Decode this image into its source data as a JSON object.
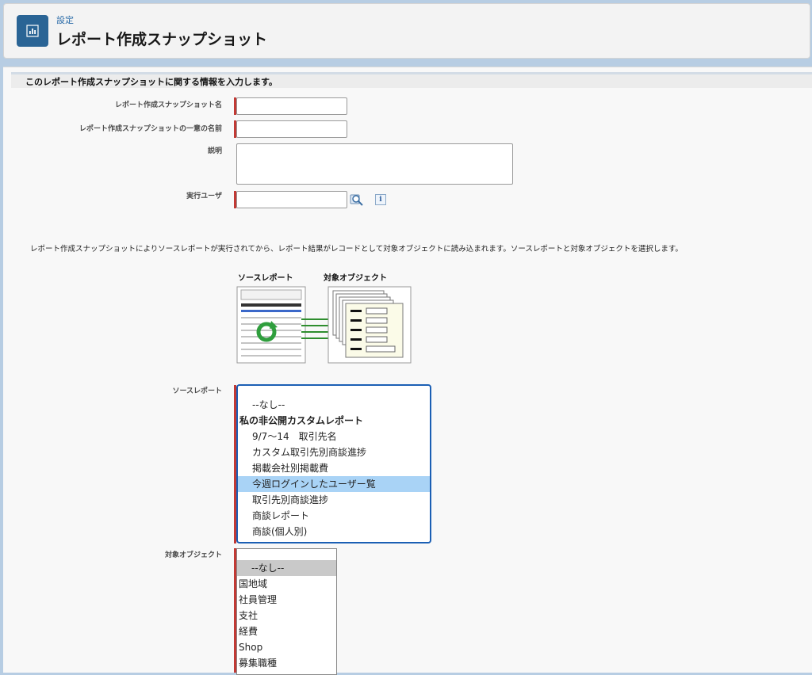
{
  "header": {
    "breadcrumb": "設定",
    "title": "レポート作成スナップショット"
  },
  "section": {
    "title": "このレポート作成スナップショットに関する情報を入力します。"
  },
  "form": {
    "name_label": "レポート作成スナップショット名",
    "unique_name_label": "レポート作成スナップショットの一意の名前",
    "description_label": "説明",
    "running_user_label": "実行ユーザ",
    "name_value": "",
    "unique_name_value": "",
    "description_value": "",
    "running_user_value": ""
  },
  "description_text": "レポート作成スナップショットによりソースレポートが実行されてから、レポート結果がレコードとして対象オブジェクトに読み込まれます。ソースレポートと対象オブジェクトを選択します。",
  "diagram": {
    "source_label": "ソースレポート",
    "target_label": "対象オブジェクト"
  },
  "source_report": {
    "label": "ソースレポート",
    "options": [
      {
        "text": "--なし--",
        "kind": "option"
      },
      {
        "text": "私の非公開カスタムレポート",
        "kind": "group"
      },
      {
        "text": "9/7〜14　取引先名",
        "kind": "option"
      },
      {
        "text": "カスタム取引先別商談進捗",
        "kind": "option"
      },
      {
        "text": "掲載会社別掲載費",
        "kind": "option"
      },
      {
        "text": "今週ログインしたユーザー覧",
        "kind": "selected"
      },
      {
        "text": "取引先別商談進捗",
        "kind": "option"
      },
      {
        "text": "商談レポート",
        "kind": "option"
      },
      {
        "text": "商談(個人別)",
        "kind": "option"
      }
    ]
  },
  "target_object": {
    "label": "対象オブジェクト",
    "options": [
      {
        "text": "--なし--",
        "kind": "grey-selected"
      },
      {
        "text": "国地域",
        "kind": "plain"
      },
      {
        "text": "社員管理",
        "kind": "plain"
      },
      {
        "text": "支社",
        "kind": "plain"
      },
      {
        "text": "経費",
        "kind": "plain"
      },
      {
        "text": "Shop",
        "kind": "plain"
      },
      {
        "text": "募集職種",
        "kind": "plain"
      }
    ]
  },
  "colors": {
    "accent": "#2a6495",
    "required": "#c23934",
    "selected_option": "#a9d3f6",
    "focus_border": "#1b5fb4"
  }
}
